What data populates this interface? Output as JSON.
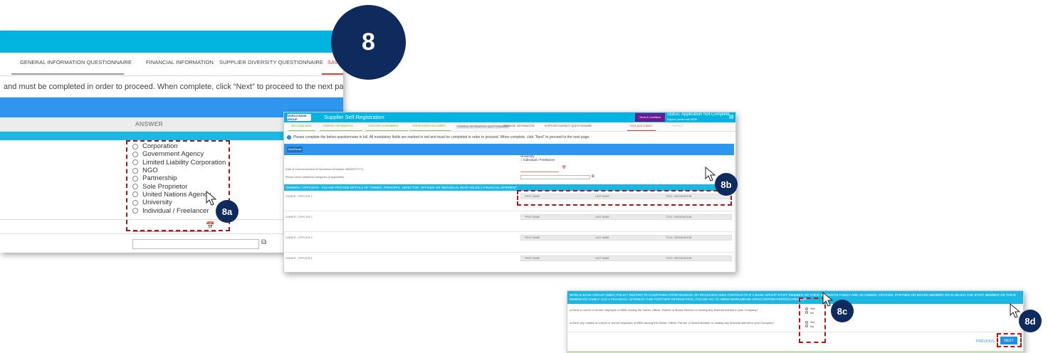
{
  "step_number": "8",
  "badges": {
    "b8a": "8a",
    "b8b": "8b",
    "b8c": "8c",
    "b8d": "8d"
  },
  "zoom": {
    "tabs": [
      {
        "label": "GENERAL INFORMATION QUESTIONNAIRE"
      },
      {
        "label": "FINANCIAL INFORMATION"
      },
      {
        "label": "SUPPLIER DIVERSITY QUESTIONNAIRE"
      },
      {
        "label": "SAV"
      }
    ],
    "notice": "and must be completed in order to proceed. When complete, click “Next” to proceed to the next page.",
    "answer_header": "ANSWER",
    "company_types": [
      "Corporation",
      "Government Agency",
      "Limited Liability Corporation",
      "NGO",
      "Partnership",
      "Sole Proprietor",
      "United Nations Agency",
      "University",
      "Individual / Freelancer"
    ]
  },
  "app": {
    "logo": "WORLD BANK GROUP",
    "title": "Supplier Self Registration",
    "terms_button": "Terms & Conditions",
    "status": "Status: Application Not Complete",
    "status_sub": "Support: please visit HERE",
    "tabs": [
      {
        "label": "WELCOME PAGE",
        "state": "done"
      },
      {
        "label": "COMPANY INFORMATION",
        "state": "done"
      },
      {
        "label": "CATEGORY ASSIGNMENT",
        "state": "done"
      },
      {
        "label": "CERTIFICATES/ DOCUMENT",
        "state": "done"
      },
      {
        "label": "GENERAL INFORMATION QUESTIONNAIRE",
        "state": "active"
      },
      {
        "label": "FINANCIAL INFORMATION",
        "state": "normal"
      },
      {
        "label": "SUPPLIER DIVERSITY QUESTIONNAIRE",
        "state": "normal"
      },
      {
        "label": "SAVE AND SUBMIT",
        "state": "alert"
      },
      {
        "label": "CONTACT",
        "state": "muted"
      }
    ],
    "notice": "Please complete the below questionnaire in full. All mandatory fields are marked in red and must be completed in order to proceed. When complete, click \"Next\" to proceed to the next page.",
    "save_button": "Save/Reuse",
    "option_fragment_1": "University",
    "option_fragment_2": "Individual / Freelancer",
    "date_label": "Date of Commencement of Operations (Example: MM/DD/YYYY)",
    "additional_label": "Please select additional categories (if applicable)",
    "owners_banner": "OWNERS / OFFICERS - PLEASE PROVIDE DETAILS OF OWNER, PRINCIPAL, DIRECTOR, OFFICER OR INDIVIDUAL WHO HOLDS A FINANCIAL INTEREST",
    "owner_columns": [
      "FIRST NAME",
      "LAST NAME",
      "TITLE / DESIGNATION"
    ],
    "owners": [
      {
        "label": "OWNER / OFFICER 1"
      },
      {
        "label": "OWNER / OFFICER 2"
      },
      {
        "label": "OWNER / OFFICER 3"
      },
      {
        "label": "OWNER / OFFICER 4"
      }
    ]
  },
  "policy": {
    "banner": "WORLD BANK GROUP (WBG) POLICY RESTRICTS COMPANIES FROM BIDDING OR RECEIVING WBG CONTRACTS IF A BANK GROUP STAFF MEMBER OR THEIR IMMEDIATE FAMILY ARE AN OWNER, OFFICER, PARTNER OR BOARD MEMBER OR IN WHICH THE STAFF MEMBER OR THEIR IMMEDIATE FAMILY HAS A FINANCIAL INTEREST. FOR FURTHER INFORMATION, PLEASE GO TO WWW.WORLDBANK.ORG/CORPORATEPROCUREMENT",
    "q1": "Is there a current or former employee of WBG among the Owner, Officer, Partner or Board Member or holding any financial interest in your Company?",
    "q2": "Is there any relative of current or former employee of WBG among the Owner, Officer, Partner or Board Member or holding any financial interest in your Company?",
    "yes": "Yes",
    "no": "No",
    "previous": "PREVIOUS",
    "next": "NEXT"
  },
  "colors": {
    "header_cyan": "#00b4e0",
    "band_blue": "#2f96f0",
    "step_navy": "#0f2a5c",
    "highlight_red": "#b3121b",
    "terms_purple": "#6b1b8e"
  }
}
